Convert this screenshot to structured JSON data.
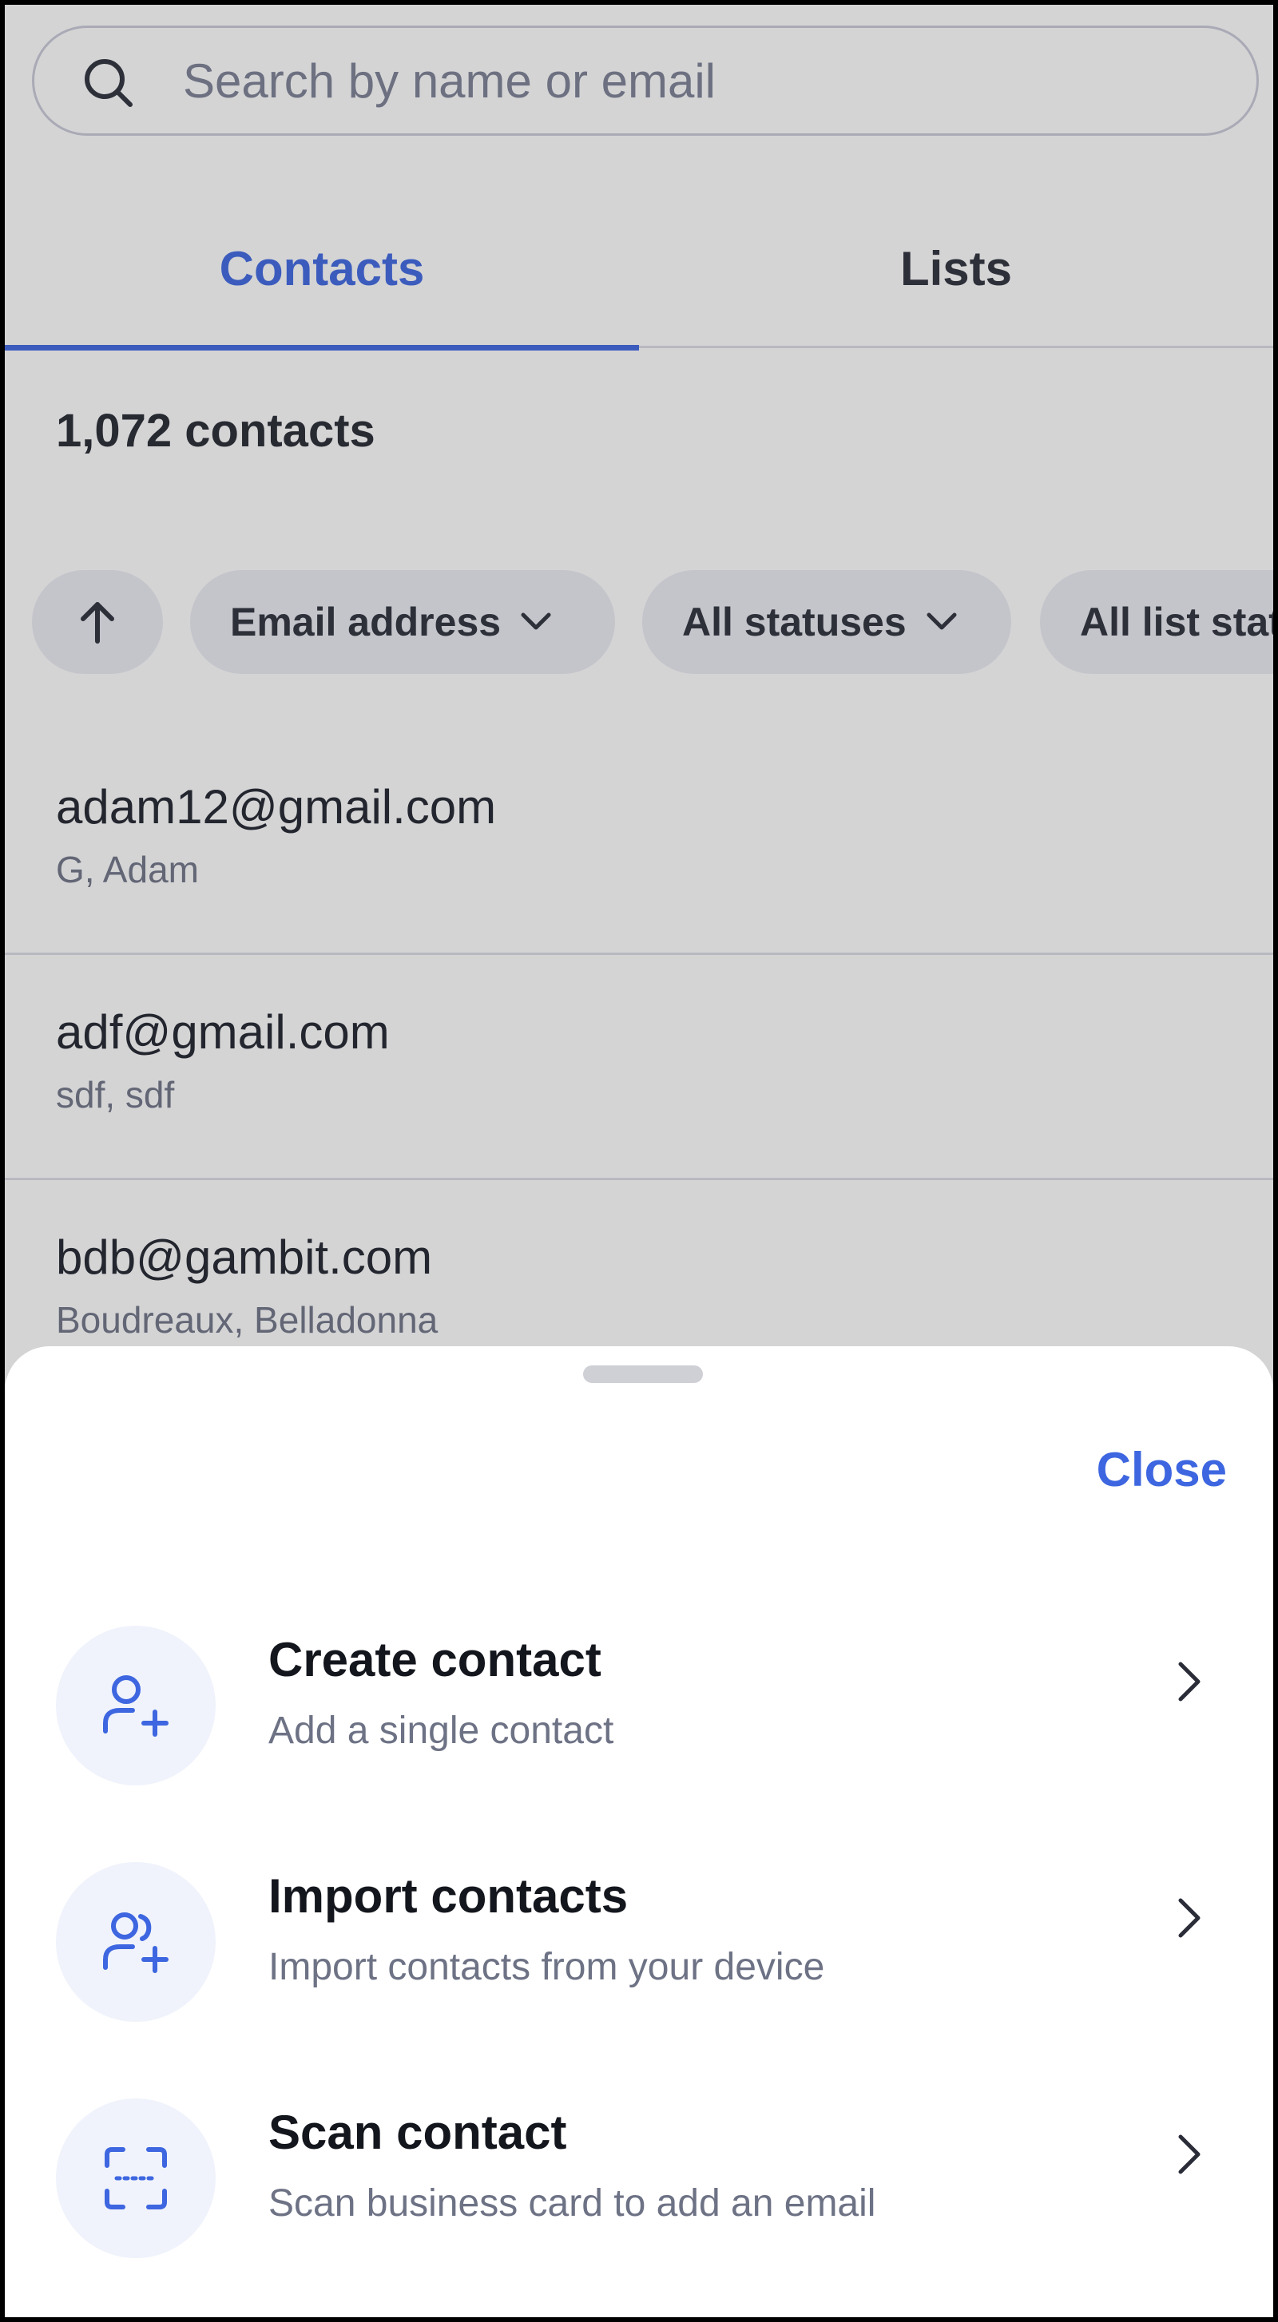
{
  "search": {
    "placeholder": "Search by name or email"
  },
  "tabs": [
    {
      "label": "Contacts",
      "active": true
    },
    {
      "label": "Lists",
      "active": false
    }
  ],
  "contacts_count": "1,072 contacts",
  "filters": {
    "sort_icon": "arrow-up-icon",
    "email": "Email address",
    "status": "All statuses",
    "list_status": "All list statuses"
  },
  "contacts": [
    {
      "email": "adam12@gmail.com",
      "name": "G, Adam"
    },
    {
      "email": "adf@gmail.com",
      "name": "sdf, sdf"
    },
    {
      "email": "bdb@gambit.com",
      "name": "Boudreaux, Belladonna"
    }
  ],
  "sheet": {
    "close": "Close",
    "actions": [
      {
        "title": "Create contact",
        "subtitle": "Add a single contact",
        "icon": "person-add-icon"
      },
      {
        "title": "Import contacts",
        "subtitle": "Import contacts from your device",
        "icon": "people-add-icon"
      },
      {
        "title": "Scan contact",
        "subtitle": "Scan business card to add an email",
        "icon": "scan-icon"
      }
    ]
  },
  "colors": {
    "accent": "#3d66e0",
    "text": "#14161d",
    "muted": "#6d7285",
    "chip": "#ebecf2"
  }
}
